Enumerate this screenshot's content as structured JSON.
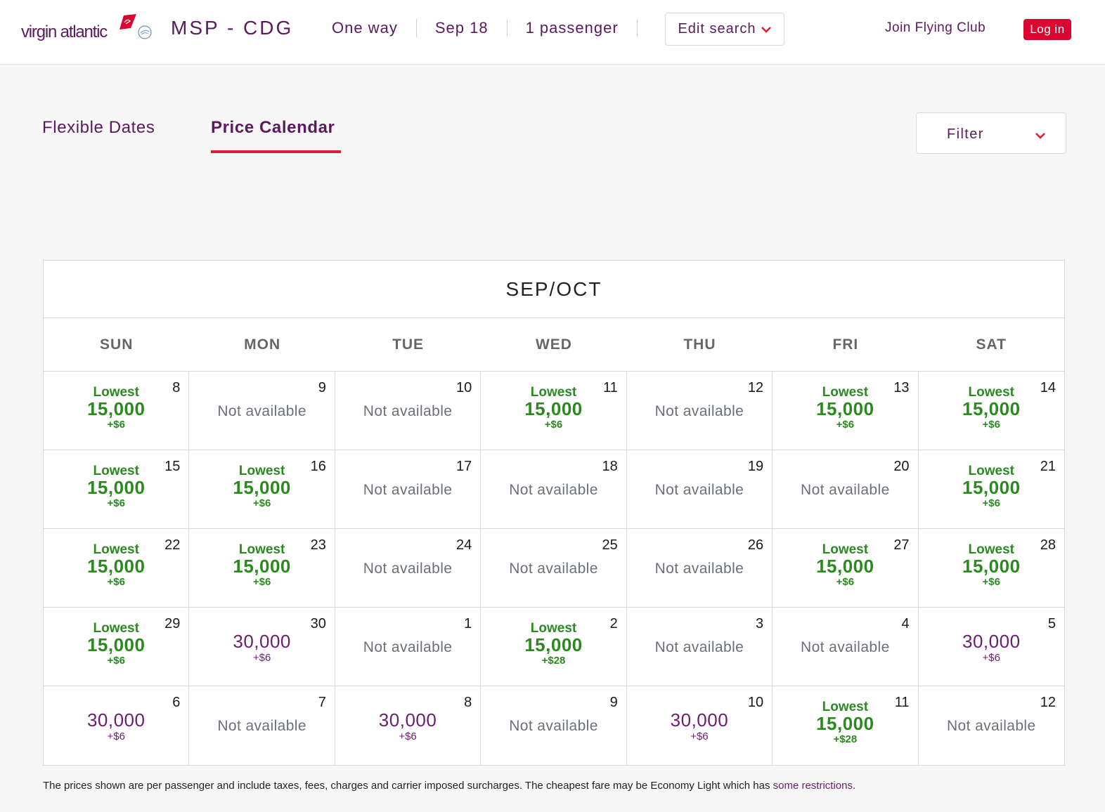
{
  "header": {
    "logo_text": "virgin atlantic",
    "route": "MSP - CDG",
    "trip_type": "One way",
    "date": "Sep 18",
    "passengers": "1 passenger",
    "edit_search_label": "Edit search",
    "join_label": "Join Flying Club",
    "login_label": "Log in"
  },
  "colors": {
    "brand_purple": "#5a1a5e",
    "brand_red": "#da0530",
    "lowest_green": "#2a8a1e",
    "unavailable_gray": "#6b6f78"
  },
  "tabs": [
    {
      "label": "Flexible Dates",
      "active": false
    },
    {
      "label": "Price Calendar",
      "active": true
    }
  ],
  "filter": {
    "label": "Filter"
  },
  "calendar": {
    "title": "SEP/OCT",
    "weekdays": [
      "SUN",
      "MON",
      "TUE",
      "WED",
      "THU",
      "FRI",
      "SAT"
    ],
    "lowest_label": "Lowest",
    "na_label": "Not available",
    "days": [
      {
        "day": "8",
        "status": "lowest",
        "points": "15,000",
        "fee": "+$6"
      },
      {
        "day": "9",
        "status": "na"
      },
      {
        "day": "10",
        "status": "na"
      },
      {
        "day": "11",
        "status": "lowest",
        "points": "15,000",
        "fee": "+$6"
      },
      {
        "day": "12",
        "status": "na"
      },
      {
        "day": "13",
        "status": "lowest",
        "points": "15,000",
        "fee": "+$6"
      },
      {
        "day": "14",
        "status": "lowest",
        "points": "15,000",
        "fee": "+$6"
      },
      {
        "day": "15",
        "status": "lowest",
        "points": "15,000",
        "fee": "+$6"
      },
      {
        "day": "16",
        "status": "lowest",
        "points": "15,000",
        "fee": "+$6"
      },
      {
        "day": "17",
        "status": "na"
      },
      {
        "day": "18",
        "status": "na"
      },
      {
        "day": "19",
        "status": "na"
      },
      {
        "day": "20",
        "status": "na"
      },
      {
        "day": "21",
        "status": "lowest",
        "points": "15,000",
        "fee": "+$6"
      },
      {
        "day": "22",
        "status": "lowest",
        "points": "15,000",
        "fee": "+$6"
      },
      {
        "day": "23",
        "status": "lowest",
        "points": "15,000",
        "fee": "+$6"
      },
      {
        "day": "24",
        "status": "na"
      },
      {
        "day": "25",
        "status": "na"
      },
      {
        "day": "26",
        "status": "na"
      },
      {
        "day": "27",
        "status": "lowest",
        "points": "15,000",
        "fee": "+$6"
      },
      {
        "day": "28",
        "status": "lowest",
        "points": "15,000",
        "fee": "+$6"
      },
      {
        "day": "29",
        "status": "lowest",
        "points": "15,000",
        "fee": "+$6"
      },
      {
        "day": "30",
        "status": "regular",
        "points": "30,000",
        "fee": "+$6"
      },
      {
        "day": "1",
        "status": "na"
      },
      {
        "day": "2",
        "status": "lowest",
        "points": "15,000",
        "fee": "+$28"
      },
      {
        "day": "3",
        "status": "na"
      },
      {
        "day": "4",
        "status": "na"
      },
      {
        "day": "5",
        "status": "regular",
        "points": "30,000",
        "fee": "+$6"
      },
      {
        "day": "6",
        "status": "regular",
        "points": "30,000",
        "fee": "+$6"
      },
      {
        "day": "7",
        "status": "na"
      },
      {
        "day": "8",
        "status": "regular",
        "points": "30,000",
        "fee": "+$6"
      },
      {
        "day": "9",
        "status": "na"
      },
      {
        "day": "10",
        "status": "regular",
        "points": "30,000",
        "fee": "+$6"
      },
      {
        "day": "11",
        "status": "lowest",
        "points": "15,000",
        "fee": "+$28"
      },
      {
        "day": "12",
        "status": "na"
      }
    ]
  },
  "footnote": {
    "text": "The prices shown are per passenger and include taxes, fees, charges and carrier imposed surcharges. The cheapest fare may be Economy Light which has ",
    "link": "some restrictions",
    "end": "."
  }
}
